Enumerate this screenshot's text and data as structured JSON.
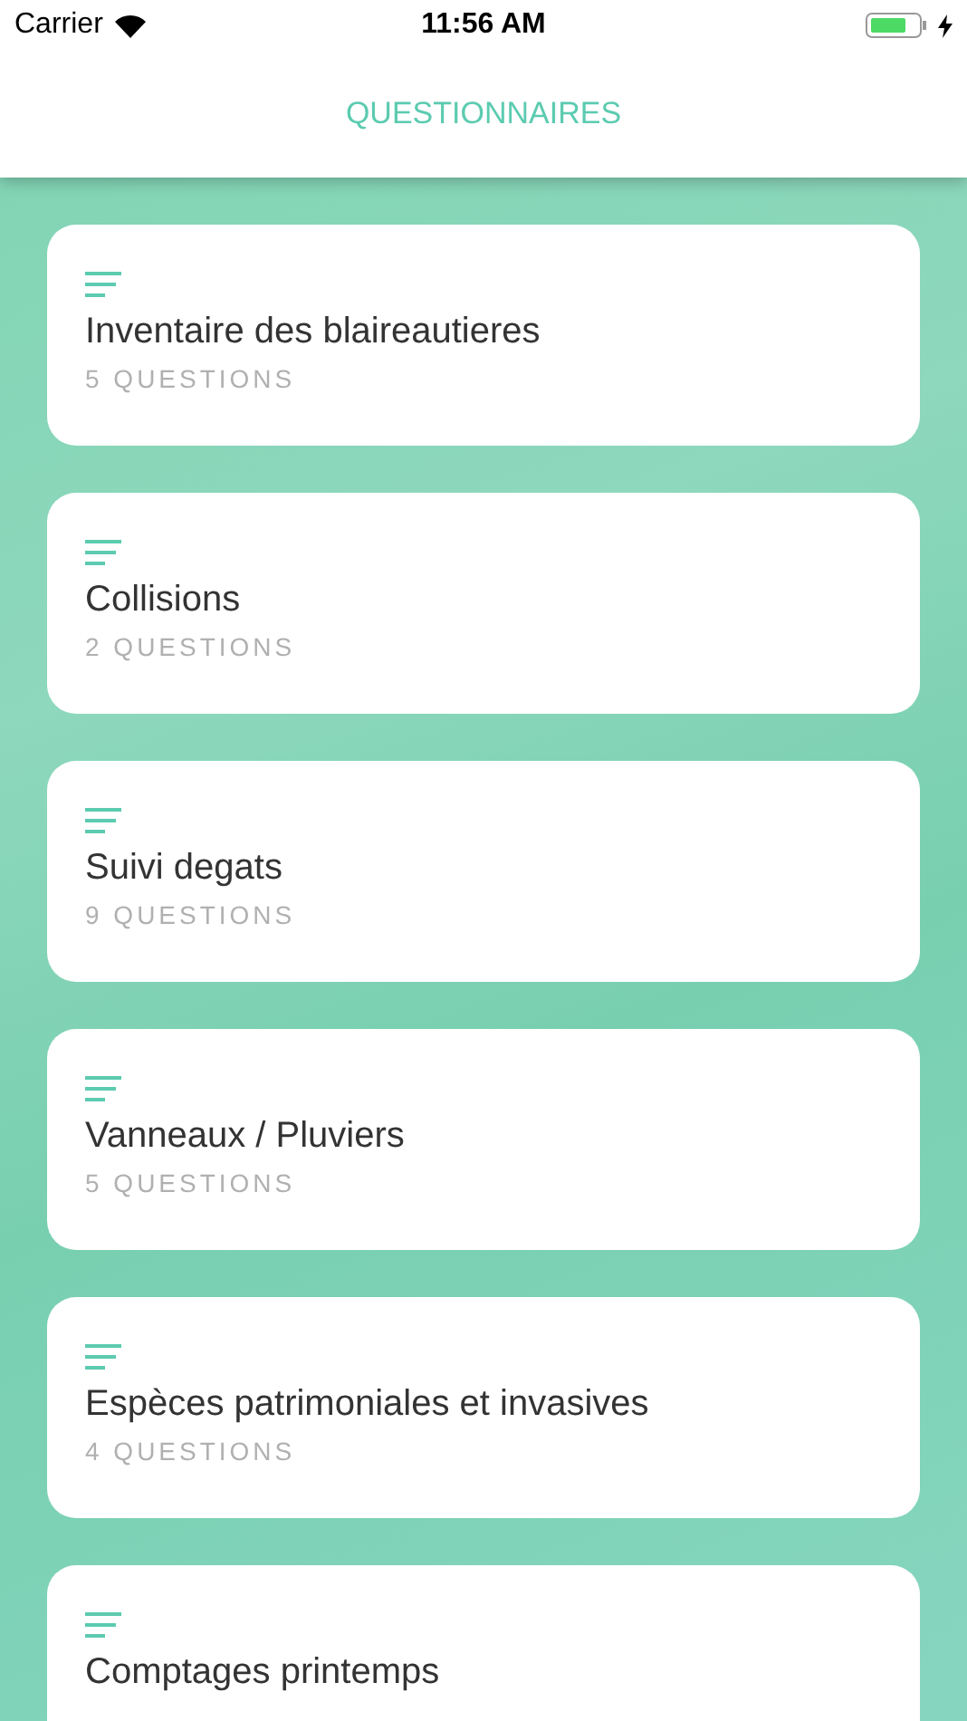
{
  "status_bar": {
    "carrier": "Carrier",
    "time": "11:56 AM"
  },
  "nav": {
    "title": "QUESTIONNAIRES"
  },
  "questionnaires": [
    {
      "title": "Inventaire des blaireautieres",
      "count": "5 QUESTIONS"
    },
    {
      "title": "Collisions",
      "count": "2 QUESTIONS"
    },
    {
      "title": "Suivi degats",
      "count": "9 QUESTIONS"
    },
    {
      "title": "Vanneaux / Pluviers",
      "count": "5 QUESTIONS"
    },
    {
      "title": "Espèces patrimoniales et invasives",
      "count": "4 QUESTIONS"
    },
    {
      "title": "Comptages printemps"
    }
  ]
}
